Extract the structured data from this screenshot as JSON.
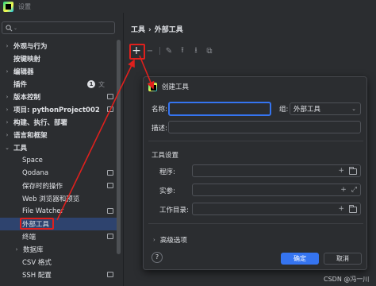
{
  "window": {
    "title": "设置"
  },
  "search": {
    "placeholder": ""
  },
  "tree": [
    {
      "label": "外观与行为",
      "level": 0,
      "arrow": "›"
    },
    {
      "label": "按键映射",
      "level": 0,
      "arrow": ""
    },
    {
      "label": "编辑器",
      "level": 0,
      "arrow": "›"
    },
    {
      "label": "插件",
      "level": 0,
      "arrow": "",
      "badge": "1"
    },
    {
      "label": "版本控制",
      "level": 0,
      "arrow": "›"
    },
    {
      "label": "项目: pythonProject002",
      "level": 0,
      "arrow": "›"
    },
    {
      "label": "构建、执行、部署",
      "level": 0,
      "arrow": "›"
    },
    {
      "label": "语言和框架",
      "level": 0,
      "arrow": "›"
    },
    {
      "label": "工具",
      "level": 0,
      "arrow": "⌄"
    },
    {
      "label": "Space",
      "level": 1,
      "arrow": ""
    },
    {
      "label": "Qodana",
      "level": 1,
      "arrow": ""
    },
    {
      "label": "保存时的操作",
      "level": 1,
      "arrow": ""
    },
    {
      "label": "Web 浏览器和预览",
      "level": 1,
      "arrow": ""
    },
    {
      "label": "File Watcher",
      "level": 1,
      "arrow": ""
    },
    {
      "label": "外部工具",
      "level": 1,
      "arrow": "",
      "selected": true
    },
    {
      "label": "终端",
      "level": 1,
      "arrow": ""
    },
    {
      "label": "数据库",
      "level": 1,
      "arrow": "›"
    },
    {
      "label": "CSV 格式",
      "level": 1,
      "arrow": ""
    },
    {
      "label": "SSH 配置",
      "level": 1,
      "arrow": ""
    }
  ],
  "breadcrumb": {
    "root": "工具",
    "sep": "›",
    "current": "外部工具"
  },
  "toolbar": {
    "add": "+",
    "remove": "−",
    "edit": "✎",
    "up": "⭱",
    "down": "⭳",
    "copy": "⧉"
  },
  "dialog": {
    "title": "创建工具",
    "name_label": "名称:",
    "name_value": "",
    "group_label": "组:",
    "group_value": "外部工具",
    "desc_label": "描述:",
    "desc_value": "",
    "section_title": "工具设置",
    "program_label": "程序:",
    "args_label": "实参:",
    "workdir_label": "工作目录:",
    "advanced_label": "高级选项",
    "help": "?",
    "ok": "确定",
    "cancel": "取消"
  },
  "watermark": "CSDN @冯一川",
  "colors": {
    "accent": "#3574f0",
    "annotation": "#e0201d",
    "selection": "#2e436e"
  }
}
